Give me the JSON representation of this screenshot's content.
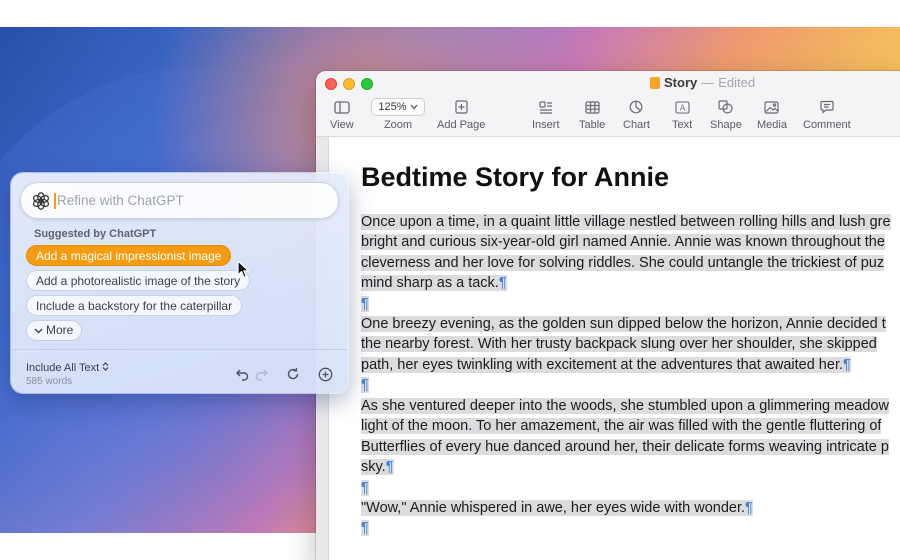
{
  "window": {
    "doc_name": "Story",
    "doc_separator": "—",
    "doc_state": "Edited"
  },
  "toolbar": {
    "zoom_value": "125%",
    "items": [
      {
        "label": "View",
        "icon": "sidebar-view-icon"
      },
      {
        "label": "Zoom",
        "icon": "zoom-dropdown"
      },
      {
        "label": "Add Page",
        "icon": "add-page-icon"
      },
      {
        "label": "Insert",
        "icon": "insert-icon"
      },
      {
        "label": "Table",
        "icon": "table-icon"
      },
      {
        "label": "Chart",
        "icon": "chart-icon"
      },
      {
        "label": "Text",
        "icon": "text-box-icon"
      },
      {
        "label": "Shape",
        "icon": "shape-icon"
      },
      {
        "label": "Media",
        "icon": "media-icon"
      },
      {
        "label": "Comment",
        "icon": "comment-icon"
      }
    ]
  },
  "document": {
    "title": "Bedtime Story for Annie",
    "pilcrow": "¶",
    "paragraphs": [
      [
        "Once upon a time, in a quaint little village nestled between rolling hills and lush gre",
        "bright and curious six-year-old girl named Annie. Annie was known throughout the",
        "cleverness and her love for solving riddles. She could untangle the trickiest of puz",
        "mind sharp as a tack."
      ],
      [
        "One breezy evening, as the golden sun dipped below the horizon, Annie decided t",
        "the nearby forest. With her trusty backpack slung over her shoulder, she skipped",
        "path, her eyes twinkling with excitement at the adventures that awaited her."
      ],
      [
        "As she ventured deeper into the woods, she stumbled upon a glimmering meadow",
        "light of the moon. To her amazement, the air was filled with the gentle fluttering of",
        "Butterflies of every hue danced around her, their delicate forms weaving intricate p",
        "sky."
      ],
      [
        "\"Wow,\" Annie whispered in awe, her eyes wide with wonder."
      ]
    ]
  },
  "chatgpt_popover": {
    "input_placeholder": "Refine with ChatGPT",
    "input_value": "",
    "suggested_heading": "Suggested by ChatGPT",
    "suggestions": [
      "Add a magical impressionist image",
      "Add a photorealistic image of the story",
      "Include a backstory for the caterpillar"
    ],
    "more_label": "More",
    "include_label": "Include All Text",
    "word_count": "585 words",
    "accent_color": "#f39c12"
  },
  "colors": {
    "selection": "#dcdcdf",
    "pilcrow": "#3b82d6",
    "close": "#fe5f57",
    "minimize": "#febc2e",
    "maximize": "#28c840"
  }
}
